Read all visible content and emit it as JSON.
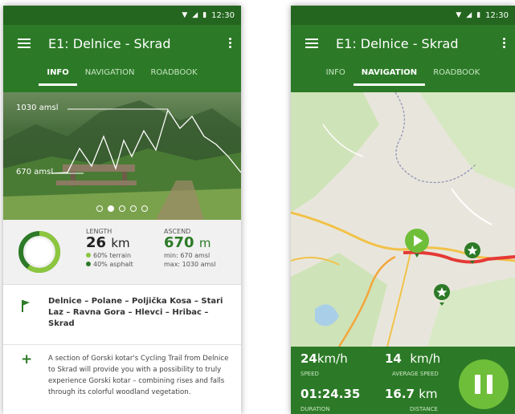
{
  "status": {
    "time": "12:30"
  },
  "left": {
    "app_title": "E1: Delnice - Skrad",
    "tabs": [
      {
        "label": "INFO",
        "active": true
      },
      {
        "label": "NAVIGATION",
        "active": false
      },
      {
        "label": "ROADBOOK",
        "active": false
      }
    ],
    "hero": {
      "elev_high": "1030 amsl",
      "elev_low": "670 amsl",
      "carousel_index": 2,
      "carousel_count": 5
    },
    "length": {
      "caption": "LENGTH",
      "value": "26",
      "unit": "km",
      "terrain": "60% terrain",
      "asphalt": "40% asphalt"
    },
    "ascend": {
      "caption": "ASCEND",
      "value": "670",
      "unit": "m",
      "min": "min: 670 amsl",
      "max": "max: 1030 amsl"
    },
    "route_text": "Delnice – Polane – Poljička Kosa – Stari Laz – Ravna Gora – Hlevci – Hribac – Skrad",
    "description": "A section of Gorski kotar's Cycling Trail from Delnice to Skrad will provide you with a possibility to truly experience Gorski kotar – combining rises and falls through its colorful woodland vegetation."
  },
  "right": {
    "app_title": "E1: Delnice - Skrad",
    "tabs": [
      {
        "label": "INFO",
        "active": false
      },
      {
        "label": "NAVIGATION",
        "active": true
      },
      {
        "label": "ROADBOOK",
        "active": false
      }
    ],
    "hud": {
      "speed": "24",
      "speed_unit": "km/h",
      "speed_caption": "SPEED",
      "avg_speed": "14",
      "avg_unit": "km/h",
      "avg_caption": "AVERAGE SPEED",
      "duration": "01:24.35",
      "duration_caption": "DURATION",
      "distance": "16.7",
      "distance_unit": "km",
      "distance_caption": "DISTANCE"
    }
  },
  "colors": {
    "primary": "#2c7a27",
    "primary_dark": "#24661f",
    "accent": "#6fbe3a",
    "route": "#e53935"
  }
}
